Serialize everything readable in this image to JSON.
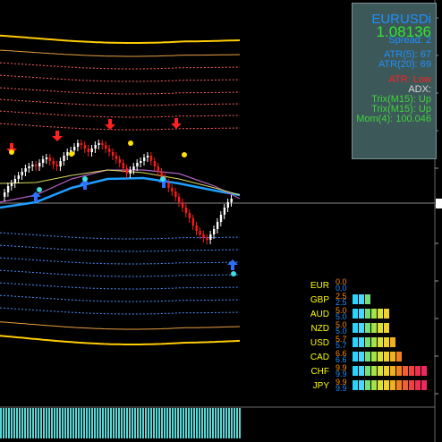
{
  "symbol": "EURUSDi",
  "bid": "1.08136",
  "spread": "Spread: 2",
  "atr5": "ATR(5): 67",
  "atr20": "ATR(20): 69",
  "atr_status": "ATR: Low",
  "adx": "ADX:",
  "trix1": "Trix(M15): Up",
  "trix2": "Trix(M15): Up",
  "mom": "Mom(4): 100.046",
  "colors": {
    "background": "#000000",
    "bull_candle": "#ffffff",
    "bear_candle": "#ff1a1a",
    "ma_main": "#1e9fff",
    "ma_slow": "#b060c0",
    "ma_fast": "#d8d860",
    "envelope_outer": "#ffcc00",
    "envelope_inner_top": "#ff6060",
    "envelope_inner_bottom": "#4f8fff",
    "histogram": "#5ad6d6",
    "info_panel": "#3d5858"
  },
  "currency_strength": [
    {
      "name": "EUR",
      "v1": "0.0",
      "v2": "0.0",
      "segments": 0
    },
    {
      "name": "GBP",
      "v1": "2.5",
      "v2": "2.5",
      "segments": 3
    },
    {
      "name": "AUD",
      "v1": "5.0",
      "v2": "5.0",
      "segments": 6
    },
    {
      "name": "NZD",
      "v1": "5.0",
      "v2": "5.0",
      "segments": 6
    },
    {
      "name": "USD",
      "v1": "5.7",
      "v2": "5.7",
      "segments": 7
    },
    {
      "name": "CAD",
      "v1": "6.6",
      "v2": "6.6",
      "segments": 8
    },
    {
      "name": "CHF",
      "v1": "9.9",
      "v2": "9.9",
      "segments": 12
    },
    {
      "name": "JPY",
      "v1": "9.9",
      "v2": "9.9",
      "segments": 12
    }
  ],
  "icons": [
    "sell-arrow-icon",
    "buy-arrow-icon",
    "signal-dot-icon"
  ]
}
